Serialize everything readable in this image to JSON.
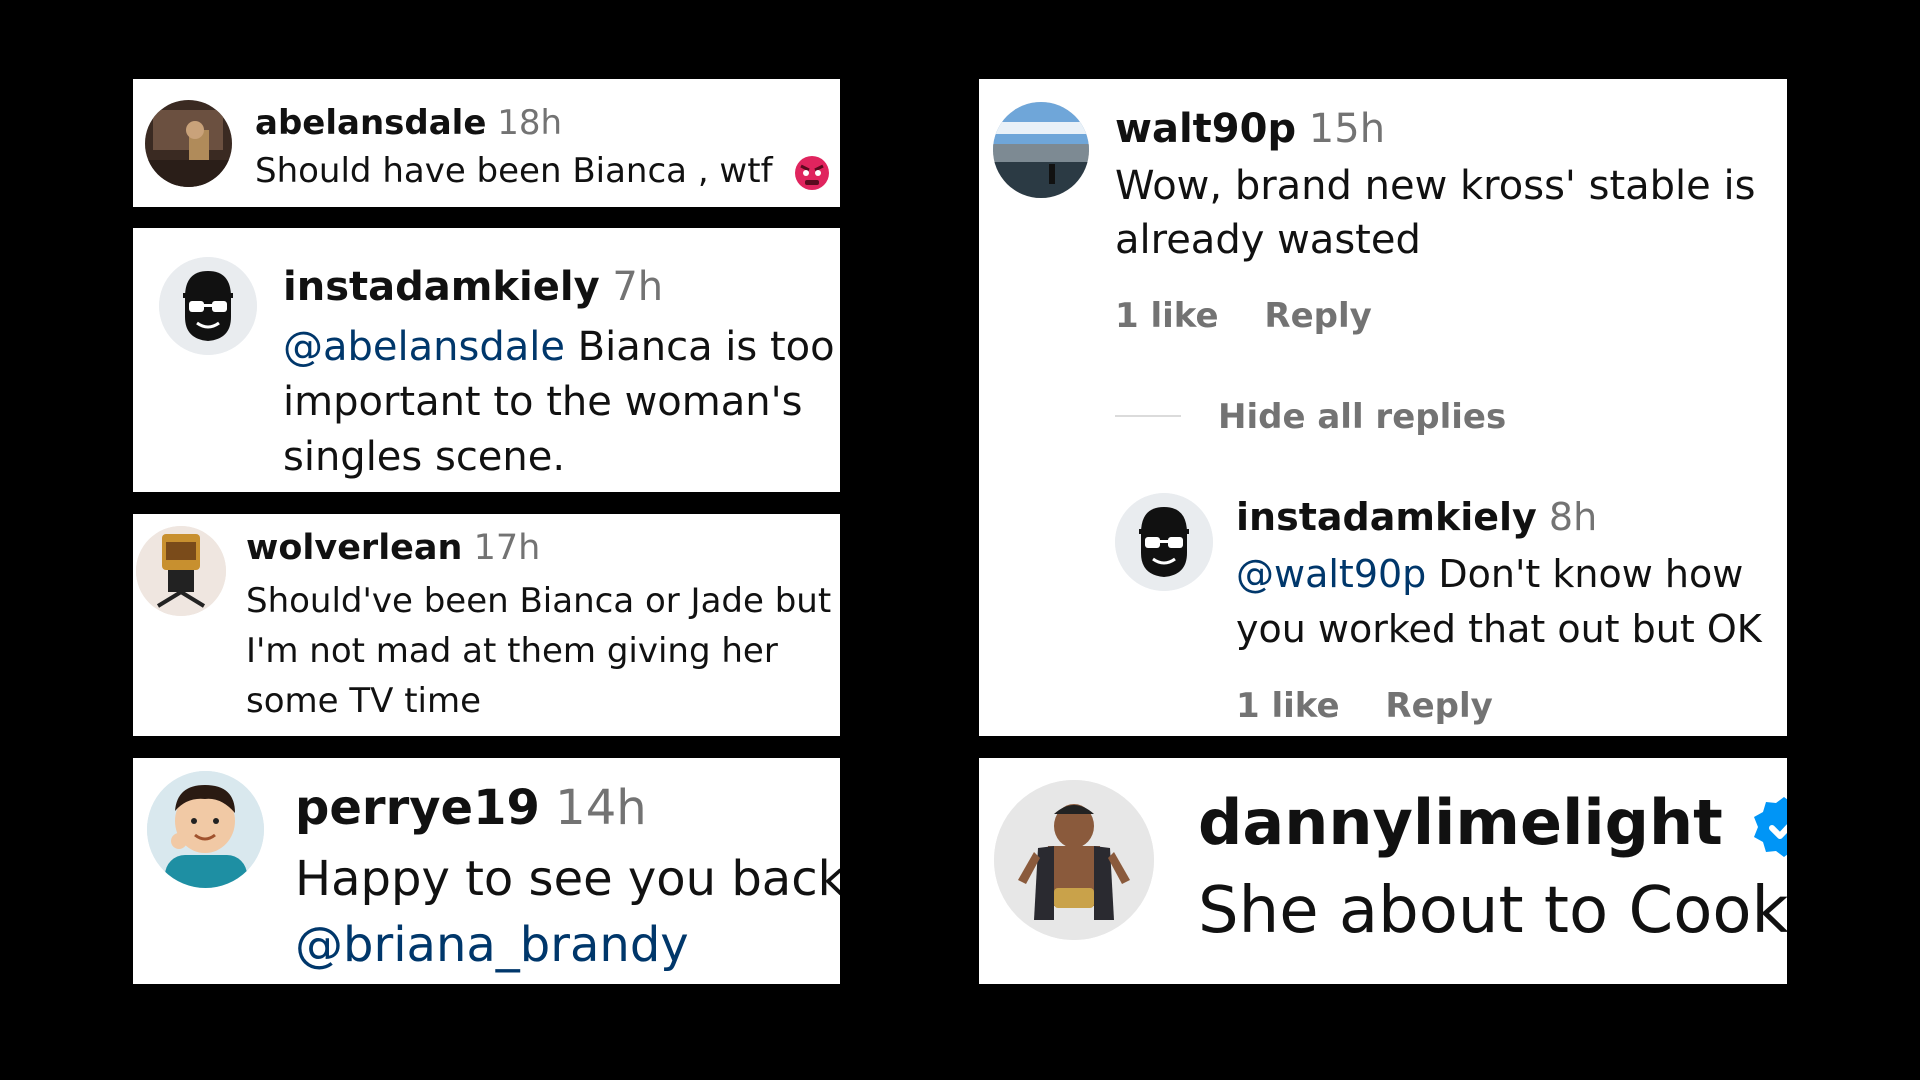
{
  "comments": [
    {
      "username": "abelansdale",
      "time": "18h",
      "text": "Should have been Bianca , wtf",
      "emoji_icon": "angry-face-icon"
    },
    {
      "username": "instadamkiely",
      "time": "7h",
      "mention": "@abelansdale",
      "lines": [
        " Bianca is too",
        "important to the woman's",
        "singles scene."
      ]
    },
    {
      "username": "wolverlean",
      "time": "17h",
      "lines": [
        "Should've been Bianca or Jade but",
        "I'm not mad at them giving her",
        "some TV time"
      ]
    },
    {
      "username": "perrye19",
      "time": "14h",
      "lines": [
        "Happy to see you back",
        "@briana_brandy"
      ]
    },
    {
      "username": "walt90p",
      "time": "15h",
      "lines": [
        "Wow, brand new kross' stable is",
        "already wasted"
      ],
      "likes": "1 like",
      "reply": "Reply",
      "hide_replies": "Hide all replies",
      "reply_comment": {
        "username": "instadamkiely",
        "time": "8h",
        "mention": "@walt90p",
        "lines": [
          " Don't know how",
          "you worked that out but OK"
        ],
        "likes": "1 like",
        "reply": "Reply"
      }
    },
    {
      "username": "dannylimelight",
      "verified_icon": "verified-badge-icon",
      "text": "She about to Cook"
    }
  ],
  "colors": {
    "background": "#000000",
    "card": "#ffffff",
    "mention": "#00376b",
    "muted": "#737373",
    "verified": "#0095f6"
  }
}
